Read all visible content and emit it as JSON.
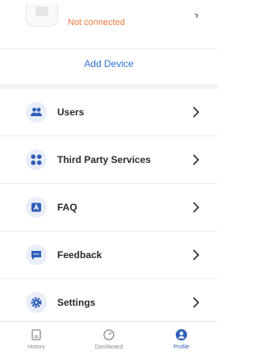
{
  "device": {
    "status": "Not connected",
    "add_label": "Add Device"
  },
  "menu": [
    {
      "label": "Users",
      "icon": "users-icon"
    },
    {
      "label": "Third Party Services",
      "icon": "third-party-services-icon"
    },
    {
      "label": "FAQ",
      "icon": "faq-icon"
    },
    {
      "label": "Feedback",
      "icon": "feedback-icon"
    },
    {
      "label": "Settings",
      "icon": "settings-gear-icon"
    }
  ],
  "tabs": [
    {
      "label": "History",
      "icon": "history-icon",
      "active": false
    },
    {
      "label": "Dashboard",
      "icon": "dashboard-gauge-icon",
      "active": false
    },
    {
      "label": "Profile",
      "icon": "profile-icon",
      "active": true
    }
  ],
  "colors": {
    "accent": "#2f5fb8",
    "link": "#2f6fdb",
    "warning": "#f07a3a",
    "icon_bg": "#e9eef8"
  }
}
